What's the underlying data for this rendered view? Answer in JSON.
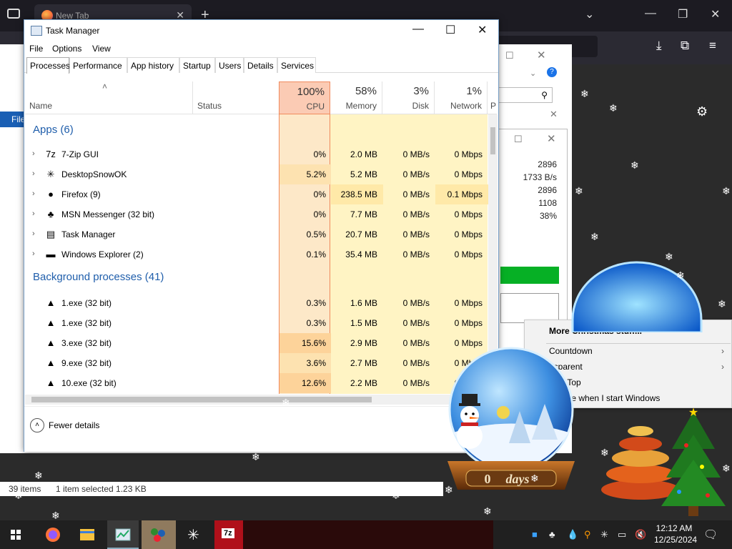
{
  "browser": {
    "tab_title": "New Tab",
    "new_tab": "+",
    "minimize": "—",
    "maximize": "❐",
    "close": "✕",
    "chevron": "⌄"
  },
  "explorer": {
    "file_label": "File",
    "status_items": "39 items",
    "status_selected": "1 item selected  1.23 KB"
  },
  "props_values": [
    "2896",
    "1733 B/s",
    "2896",
    "1108",
    "38%"
  ],
  "task_manager": {
    "title": "Task Manager",
    "menu": [
      "File",
      "Options",
      "View"
    ],
    "tabs": [
      "Processes",
      "Performance",
      "App history",
      "Startup",
      "Users",
      "Details",
      "Services"
    ],
    "active_tab": "Processes",
    "columns": {
      "name": "Name",
      "status": "Status",
      "cpu_pct": "100%",
      "cpu": "CPU",
      "mem_pct": "58%",
      "mem": "Memory",
      "disk_pct": "3%",
      "disk": "Disk",
      "net_pct": "1%",
      "net": "Network",
      "power": "P"
    },
    "apps_header": "Apps (6)",
    "bg_header": "Background processes (41)",
    "apps": [
      {
        "name": "7-Zip GUI",
        "icon": "7z-icon",
        "glyph": "7z",
        "cpu": "0%",
        "mem": "2.0 MB",
        "disk": "0 MB/s",
        "net": "0 Mbps"
      },
      {
        "name": "DesktopSnowOK",
        "icon": "snowflake-icon",
        "glyph": "✳",
        "cpu": "5.2%",
        "mem": "5.2 MB",
        "disk": "0 MB/s",
        "net": "0 Mbps"
      },
      {
        "name": "Firefox (9)",
        "icon": "firefox-icon",
        "glyph": "●",
        "cpu": "0%",
        "mem": "238.5 MB",
        "disk": "0 MB/s",
        "net": "0.1 Mbps"
      },
      {
        "name": "MSN Messenger (32 bit)",
        "icon": "msn-icon",
        "glyph": "♣",
        "cpu": "0%",
        "mem": "7.7 MB",
        "disk": "0 MB/s",
        "net": "0 Mbps"
      },
      {
        "name": "Task Manager",
        "icon": "task-manager-icon",
        "glyph": "▤",
        "cpu": "0.5%",
        "mem": "20.7 MB",
        "disk": "0 MB/s",
        "net": "0 Mbps"
      },
      {
        "name": "Windows Explorer (2)",
        "icon": "folder-icon",
        "glyph": "▬",
        "cpu": "0.1%",
        "mem": "35.4 MB",
        "disk": "0 MB/s",
        "net": "0 Mbps"
      }
    ],
    "background": [
      {
        "name": "1.exe (32 bit)",
        "icon": "tree-icon",
        "glyph": "▲",
        "cpu": "0.3%",
        "mem": "1.6 MB",
        "disk": "0 MB/s",
        "net": "0 Mbps"
      },
      {
        "name": "1.exe (32 bit)",
        "icon": "tree-icon",
        "glyph": "▲",
        "cpu": "0.3%",
        "mem": "1.5 MB",
        "disk": "0 MB/s",
        "net": "0 Mbps"
      },
      {
        "name": "3.exe (32 bit)",
        "icon": "tree-icon",
        "glyph": "▲",
        "cpu": "15.6%",
        "mem": "2.9 MB",
        "disk": "0 MB/s",
        "net": "0 Mbps"
      },
      {
        "name": "9.exe (32 bit)",
        "icon": "tree-icon",
        "glyph": "▲",
        "cpu": "3.6%",
        "mem": "2.7 MB",
        "disk": "0 MB/s",
        "net": "0 Mbps"
      },
      {
        "name": "10.exe (32 bit)",
        "icon": "tree-icon",
        "glyph": "▲",
        "cpu": "12.6%",
        "mem": "2.2 MB",
        "disk": "0 MB/s",
        "net": "0 Mbps"
      }
    ],
    "fewer_details": "Fewer details"
  },
  "context_menu": {
    "items": [
      {
        "label": "More Christmas stuff...",
        "bold": true,
        "submenu": false
      },
      {
        "label": "Countdown",
        "bold": false,
        "submenu": true
      },
      {
        "label": "nsparent",
        "bold": false,
        "submenu": true
      },
      {
        "label": "s OnTop",
        "bold": false,
        "submenu": false
      },
      {
        "label": "wglobe when I start Windows",
        "bold": false,
        "submenu": false
      }
    ]
  },
  "snowglobe": {
    "days_value": "0",
    "days_label": "days"
  },
  "taskbar": {
    "clock_time": "12:12 AM",
    "clock_date": "12/25/2024"
  },
  "colors": {
    "accent_blue": "#1f5eab",
    "cpu_header": "#fbcbb4",
    "cpu_column": "#fde8c8",
    "heat_light": "#fff4c4",
    "heat_mid": "#ffe9a8",
    "taskbar": "#202020"
  }
}
